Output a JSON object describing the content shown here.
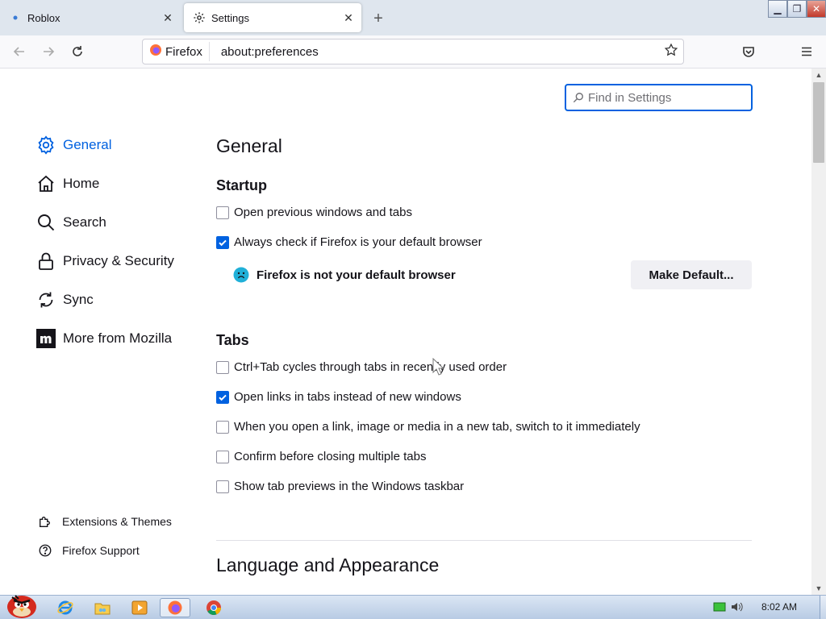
{
  "tabs": [
    {
      "title": "Roblox",
      "active": false
    },
    {
      "title": "Settings",
      "active": true
    }
  ],
  "urlbar": {
    "identity": "Firefox",
    "url": "about:preferences"
  },
  "search": {
    "placeholder": "Find in Settings"
  },
  "sidebar": {
    "items": [
      {
        "label": "General",
        "icon": "gear-icon",
        "selected": true
      },
      {
        "label": "Home",
        "icon": "home-icon"
      },
      {
        "label": "Search",
        "icon": "search-icon"
      },
      {
        "label": "Privacy & Security",
        "icon": "lock-icon"
      },
      {
        "label": "Sync",
        "icon": "sync-icon"
      },
      {
        "label": "More from Mozilla",
        "icon": "mozilla-icon"
      }
    ],
    "footer": [
      {
        "label": "Extensions & Themes",
        "icon": "puzzle-icon"
      },
      {
        "label": "Firefox Support",
        "icon": "help-icon"
      }
    ]
  },
  "main": {
    "title": "General",
    "startup": {
      "heading": "Startup",
      "options": [
        {
          "label": "Open previous windows and tabs",
          "checked": false
        },
        {
          "label": "Always check if Firefox is your default browser",
          "checked": true
        }
      ],
      "default_status": "Firefox is not your default browser",
      "make_default_button": "Make Default..."
    },
    "tabs_section": {
      "heading": "Tabs",
      "options": [
        {
          "label": "Ctrl+Tab cycles through tabs in recently used order",
          "checked": false
        },
        {
          "label": "Open links in tabs instead of new windows",
          "checked": true
        },
        {
          "label": "When you open a link, image or media in a new tab, switch to it immediately",
          "checked": false
        },
        {
          "label": "Confirm before closing multiple tabs",
          "checked": false
        },
        {
          "label": "Show tab previews in the Windows taskbar",
          "checked": false
        }
      ]
    },
    "next_section": "Language and Appearance"
  },
  "taskbar": {
    "clock": "8:02 AM"
  },
  "colors": {
    "accent": "#0061e0",
    "tabstrip": "#dfe6ee"
  }
}
